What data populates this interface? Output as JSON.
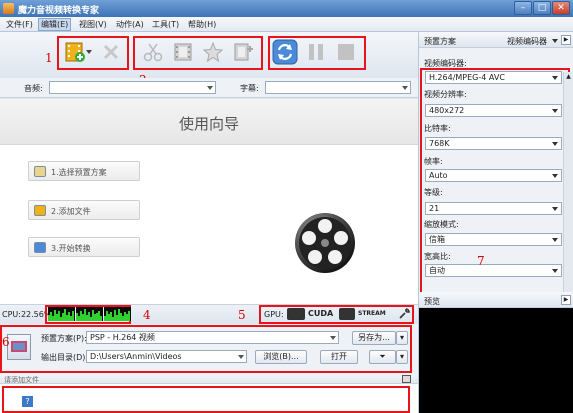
{
  "window": {
    "title": "魔力音视频转换专家"
  },
  "menu": {
    "items": [
      "文件(F)",
      "编辑(E)",
      "视图(V)",
      "动作(A)",
      "工具(T)",
      "帮助(H)"
    ]
  },
  "source": {
    "audio_label": "音频:",
    "subtitle_label": "字幕:"
  },
  "wizard": {
    "title": "使用向导",
    "steps": [
      "1.选择预置方案",
      "2.添加文件",
      "3.开始转换"
    ]
  },
  "status": {
    "cpu_label": "CPU:22.56%",
    "gpu_label": "GPU:",
    "cuda_label": "CUDA",
    "stream_label": "STREAM"
  },
  "output": {
    "preset_label": "预置方案(P):",
    "preset_value": "PSP - H.264 视频",
    "save_as_label": "另存为...",
    "dir_label": "输出目录(D):",
    "dir_value": "D:\\Users\\Anmin\\Videos",
    "browse_label": "浏览(B)...",
    "open_label": "打开"
  },
  "filelist": {
    "header": "请添加文件"
  },
  "right_panel": {
    "title": "预置方案",
    "dropdown_label": "视频编码器",
    "settings": [
      {
        "label": "视频编码器:",
        "value": "H.264/MPEG-4 AVC"
      },
      {
        "label": "视频分辨率:",
        "value": "480x272"
      },
      {
        "label": "比特率:",
        "value": "768K"
      },
      {
        "label": "帧率:",
        "value": "Auto"
      },
      {
        "label": "等级:",
        "value": "21"
      },
      {
        "label": "缩放模式:",
        "value": "信箱"
      },
      {
        "label": "宽高比:",
        "value": "自动"
      }
    ],
    "preview_title": "预览"
  },
  "annotations": [
    "1",
    "2",
    "3",
    "4",
    "5",
    "6",
    "7"
  ],
  "colors": {
    "annotation_red": "#e8141b",
    "title_blue": "#3e73b6",
    "meter_green": "#2fd12f"
  }
}
